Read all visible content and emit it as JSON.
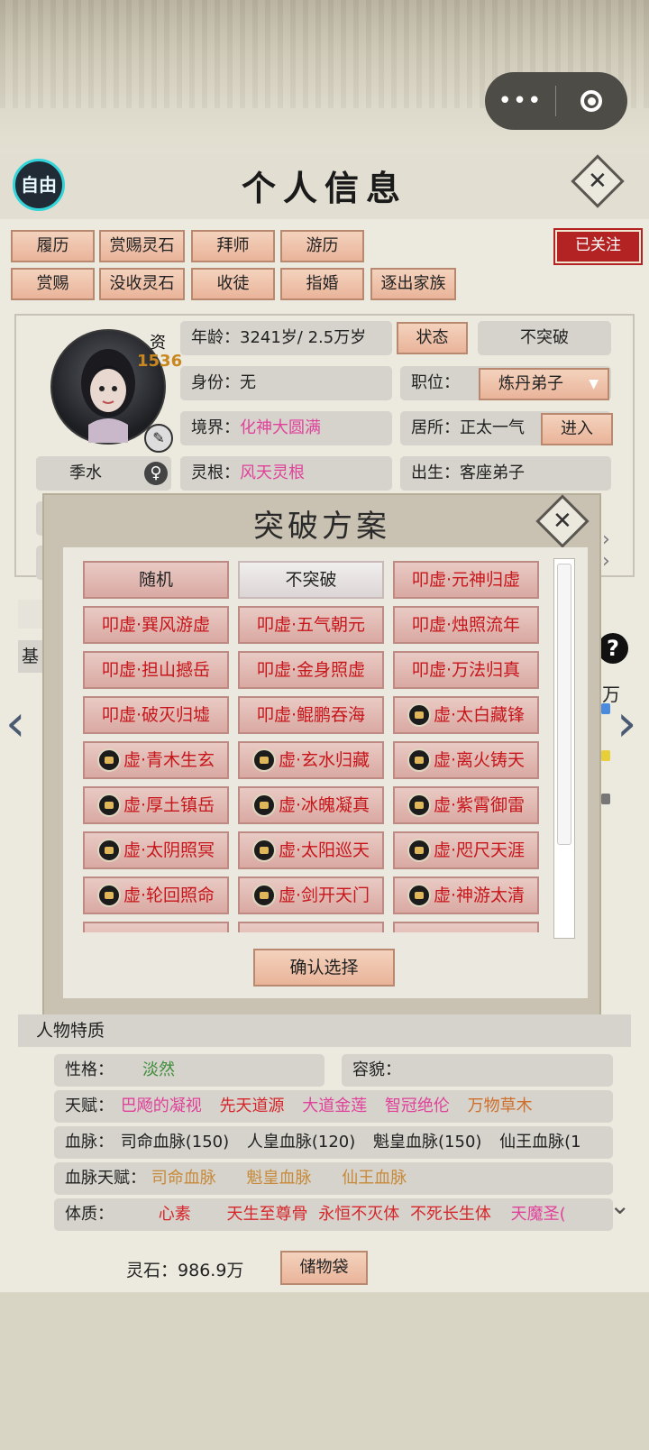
{
  "header": {
    "free_label": "自由",
    "title": "个人信息",
    "close_glyph": "✕",
    "capsule": {
      "menu_glyph": "•••",
      "target_icon": "target-icon"
    }
  },
  "actions": {
    "row1": [
      "履历",
      "赏赐灵石",
      "拜师",
      "游历"
    ],
    "row2": [
      "赏赐",
      "没收灵石",
      "收徒",
      "指婚",
      "逐出家族"
    ],
    "follow_label": "已关注"
  },
  "profile": {
    "aptitude_label": "资",
    "aptitude_value": "1536",
    "name": "季水",
    "gender_glyph": "♀",
    "age_label": "年龄：",
    "age_value": "3241岁/ 2.5万岁",
    "status_button": "状态",
    "breakthrough_state": "不突破",
    "identity_label": "身份：",
    "identity_value": "无",
    "position_label": "职位：",
    "position_value": "炼丹弟子",
    "realm_label": "境界：",
    "realm_value": "化神大圆满",
    "residence_label": "居所：",
    "residence_value": "正太一气",
    "residence_tail": ")",
    "enter_button": "进入",
    "root_label": "灵根：",
    "root_value": "风天灵根",
    "birth_label": "出生：",
    "birth_value": "客座弟子"
  },
  "partial": {
    "section_head": "基",
    "unit": "万",
    "help_glyph": "?"
  },
  "modal": {
    "title": "突破方案",
    "close_glyph": "✕",
    "options": [
      {
        "label": "随机",
        "style": "plain"
      },
      {
        "label": "不突破",
        "style": "selected"
      },
      {
        "label": "叩虚·元神归虚",
        "style": "red"
      },
      {
        "label": "叩虚·巽风游虚",
        "style": "red"
      },
      {
        "label": "叩虚·五气朝元",
        "style": "red"
      },
      {
        "label": "叩虚·烛照流年",
        "style": "red"
      },
      {
        "label": "叩虚·担山撼岳",
        "style": "red"
      },
      {
        "label": "叩虚·金身照虚",
        "style": "red"
      },
      {
        "label": "叩虚·万法归真",
        "style": "red"
      },
      {
        "label": "叩虚·破灭归墟",
        "style": "red"
      },
      {
        "label": "叩虚·鲲鹏吞海",
        "style": "red"
      },
      {
        "label": "虚·太白藏锋",
        "style": "locked"
      },
      {
        "label": "虚·青木生玄",
        "style": "locked"
      },
      {
        "label": "虚·玄水归藏",
        "style": "locked"
      },
      {
        "label": "虚·离火铸天",
        "style": "locked"
      },
      {
        "label": "虚·厚土镇岳",
        "style": "locked"
      },
      {
        "label": "虚·冰魄凝真",
        "style": "locked"
      },
      {
        "label": "虚·紫霄御雷",
        "style": "locked"
      },
      {
        "label": "虚·太阴照冥",
        "style": "locked"
      },
      {
        "label": "虚·太阳巡天",
        "style": "locked"
      },
      {
        "label": "虚·咫尺天涯",
        "style": "locked"
      },
      {
        "label": "虚·轮回照命",
        "style": "locked"
      },
      {
        "label": "虚·剑开天门",
        "style": "locked"
      },
      {
        "label": "虚·神游太清",
        "style": "locked"
      }
    ],
    "confirm_label": "确认选择"
  },
  "traits": {
    "section_title": "人物特质",
    "personality_label": "性格：",
    "personality_value": "淡然",
    "appearance_label": "容貌：",
    "talent_label": "天赋：",
    "talents": [
      "巴飏的凝视",
      "先天道源",
      "大道金莲",
      "智冠绝伦",
      "万物草木"
    ],
    "bloodline_label": "血脉：",
    "bloodlines": [
      "司命血脉(150)",
      "人皇血脉(120)",
      "魁皇血脉(150)",
      "仙王血脉(1"
    ],
    "bloodline_talent_label": "血脉天赋：",
    "bloodline_talents": [
      "司命血脉",
      "魁皇血脉",
      "仙王血脉"
    ],
    "physique_label": "体质：",
    "physiques": [
      "心素",
      "天生至尊骨",
      "永恒不灭体",
      "不死长生体",
      "天魔圣("
    ]
  },
  "footer": {
    "stones_label": "灵石：",
    "stones_value": "986.9万",
    "bag_button": "储物袋"
  },
  "colors": {
    "accent_red": "#c7161b",
    "pink": "#e0429a",
    "follow_bg": "#b42323",
    "free_ring": "#33d4d9"
  }
}
